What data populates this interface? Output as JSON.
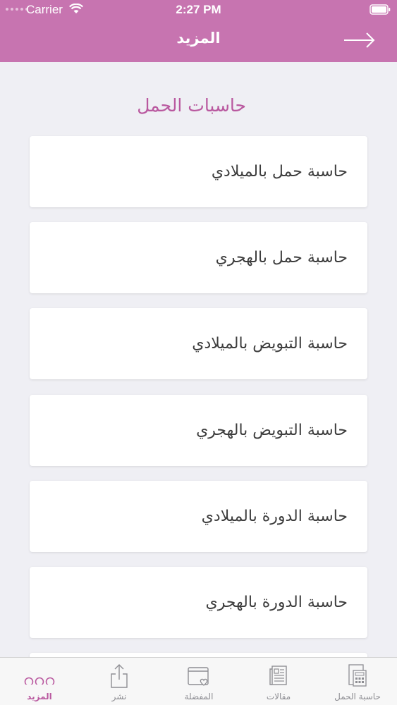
{
  "status_bar": {
    "carrier": "Carrier",
    "time": "2:27 PM"
  },
  "header": {
    "title": "المزيد"
  },
  "section": {
    "title": "حاسبات الحمل"
  },
  "items": [
    {
      "label": "حاسبة حمل بالميلادي"
    },
    {
      "label": "حاسبة حمل بالهجري"
    },
    {
      "label": "حاسبة التبويض بالميلادي"
    },
    {
      "label": "حاسبة التبويض بالهجري"
    },
    {
      "label": "حاسبة الدورة بالميلادي"
    },
    {
      "label": "حاسبة الدورة بالهجري"
    }
  ],
  "tabs": [
    {
      "label": "المزيد",
      "icon": "more-dots-icon",
      "active": true
    },
    {
      "label": "نشر",
      "icon": "share-icon",
      "active": false
    },
    {
      "label": "المفضلة",
      "icon": "favorites-icon",
      "active": false
    },
    {
      "label": "مقالات",
      "icon": "articles-icon",
      "active": false
    },
    {
      "label": "حاسبة الحمل",
      "icon": "calculator-icon",
      "active": false
    }
  ],
  "colors": {
    "accent": "#c774b0",
    "section_title": "#b9589f",
    "background": "#efeff4"
  }
}
